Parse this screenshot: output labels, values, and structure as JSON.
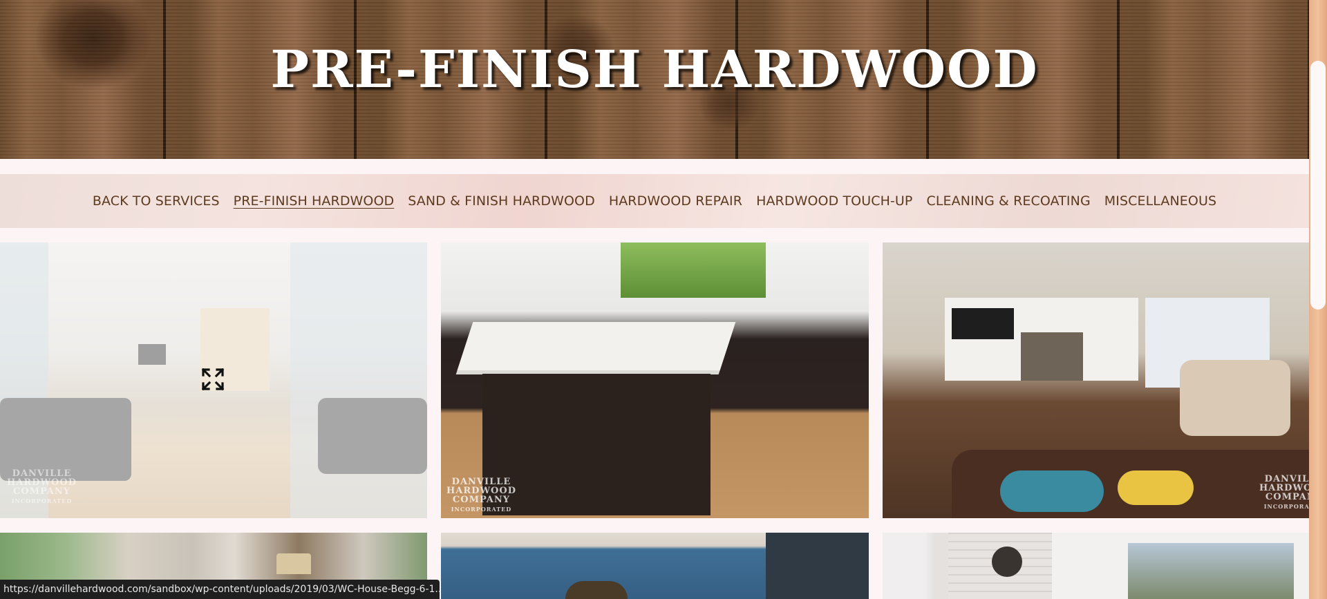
{
  "banner": {
    "title": "PRE-FINISH HARDWOOD"
  },
  "nav": {
    "items": [
      {
        "label": "BACK TO SERVICES"
      },
      {
        "label": "PRE-FINISH HARDWOOD"
      },
      {
        "label": "SAND & FINISH HARDWOOD"
      },
      {
        "label": "HARDWOOD REPAIR"
      },
      {
        "label": "HARDWOOD TOUCH-UP"
      },
      {
        "label": "CLEANING & RECOATING"
      },
      {
        "label": "MISCELLANEOUS"
      }
    ],
    "active": "PRE-FINISH HARDWOOD"
  },
  "gallery": {
    "watermark": [
      "DANVILLE",
      "HARDWOOD",
      "COMPANY",
      "INCORPORATED"
    ],
    "items": [
      {
        "subject": "living room with light oak floor",
        "hovered": true,
        "icon": "expand-icon"
      },
      {
        "subject": "kitchen with marble island and oak floor"
      },
      {
        "subject": "family room with fireplace and dark hardwood floor"
      },
      {
        "subject": "room with window and lamp"
      },
      {
        "subject": "blue dining room with pendant light"
      },
      {
        "subject": "room with white brick fireplace and clock"
      }
    ]
  },
  "status_bar": {
    "url": "https://danvillehardwood.com/sandbox/wp-content/uploads/2019/03/WC-House-Begg-6-1...."
  },
  "colors": {
    "nav_text": "#5c3a1e",
    "page_bg": "#fdf5f5",
    "scroll_track": "#efbb94"
  }
}
